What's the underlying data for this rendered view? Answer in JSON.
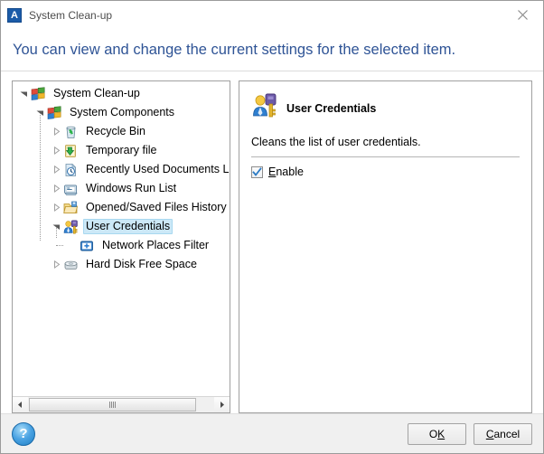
{
  "window": {
    "title": "System Clean-up",
    "app_icon": "app-letter-a-icon",
    "close_icon": "close-icon",
    "banner_text": "You can view and change the current settings for the selected item."
  },
  "tree": {
    "name": "system-cleanup-tree",
    "items": [
      {
        "label": "System Clean-up",
        "level": 0,
        "icon": "windows-logo-icon",
        "twisty": "expanded",
        "selected": false
      },
      {
        "label": "System Components",
        "level": 1,
        "icon": "windows-logo-icon",
        "twisty": "expanded",
        "selected": false
      },
      {
        "label": "Recycle Bin",
        "level": 2,
        "icon": "recycle-bin-icon",
        "twisty": "collapsed",
        "selected": false
      },
      {
        "label": "Temporary file",
        "level": 2,
        "icon": "temporary-file-icon",
        "twisty": "collapsed",
        "selected": false
      },
      {
        "label": "Recently Used Documents List",
        "level": 2,
        "icon": "recent-documents-icon",
        "twisty": "collapsed",
        "selected": false
      },
      {
        "label": "Windows Run List",
        "level": 2,
        "icon": "run-list-icon",
        "twisty": "collapsed",
        "selected": false
      },
      {
        "label": "Opened/Saved Files History",
        "level": 2,
        "icon": "opened-saved-files-icon",
        "twisty": "collapsed",
        "selected": false
      },
      {
        "label": "User Credentials",
        "level": 2,
        "icon": "user-credentials-icon",
        "twisty": "expanded",
        "selected": true
      },
      {
        "label": "Network Places Filter",
        "level": 3,
        "icon": "network-places-icon",
        "twisty": "none",
        "selected": false
      },
      {
        "label": "Hard Disk Free Space",
        "level": 2,
        "icon": "hard-disk-icon",
        "twisty": "collapsed",
        "selected": false
      }
    ],
    "scrollbar": {
      "left_arrow": "scroll-left-icon",
      "right_arrow": "scroll-right-icon"
    }
  },
  "detail": {
    "icon": "user-credentials-icon",
    "title": "User Credentials",
    "description": "Cleans the list of user credentials.",
    "enable": {
      "label_accel": "E",
      "label_rest": "nable",
      "checked": true
    }
  },
  "footer": {
    "help_icon": "help-question-icon",
    "help_glyph": "?",
    "ok": {
      "accel": "K",
      "before": "O",
      "after": ""
    },
    "cancel": {
      "accel": "C",
      "before": "",
      "after": "ancel"
    }
  },
  "colors": {
    "banner_text": "#2f5496",
    "selection": "#cce8f7",
    "footer_bg": "#f0f0f0",
    "accent": "#1b5ba8"
  }
}
